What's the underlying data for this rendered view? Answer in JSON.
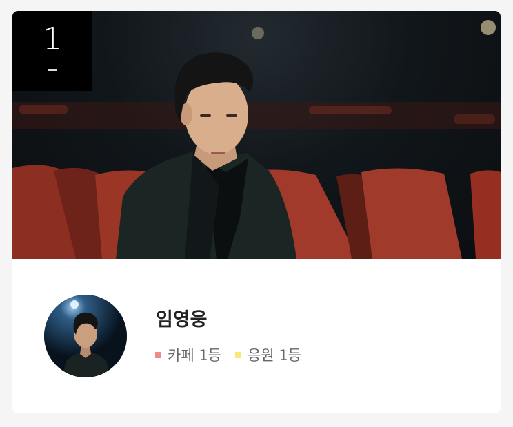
{
  "rank": {
    "number": "1",
    "change_symbol": "–"
  },
  "artist": {
    "name": "임영웅"
  },
  "stats": [
    {
      "label": "카페 1등",
      "color": "#f08a8a"
    },
    {
      "label": "응원 1등",
      "color": "#f6ea7a"
    }
  ],
  "colors": {
    "card_bg": "#ffffff",
    "page_bg": "#f5f5f5",
    "rank_bg": "#000000"
  }
}
